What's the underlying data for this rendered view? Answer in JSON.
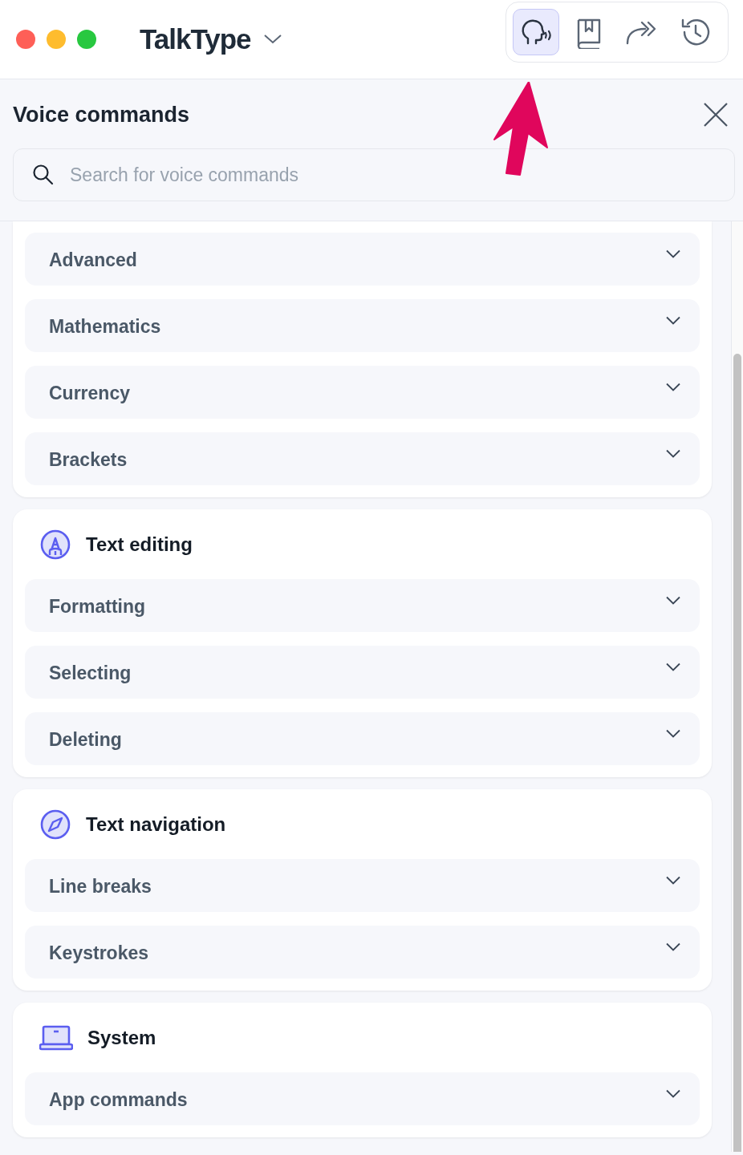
{
  "window": {
    "title": "TalkType",
    "traffic_lights": [
      {
        "color": "#fe5f57"
      },
      {
        "color": "#febc2e"
      },
      {
        "color": "#28c840"
      }
    ]
  },
  "toolbar": [
    {
      "kind": "voice",
      "selected": true
    },
    {
      "kind": "book",
      "selected": false
    },
    {
      "kind": "share",
      "selected": false
    },
    {
      "kind": "history",
      "selected": false
    }
  ],
  "panel": {
    "title": "Voice commands",
    "search": {
      "placeholder": "Search for voice commands"
    },
    "sections": [
      {
        "items": [
          {
            "label": "Advanced",
            "expanded": false
          },
          {
            "label": "Mathematics",
            "expanded": false
          },
          {
            "label": "Currency",
            "expanded": false
          },
          {
            "label": "Brackets",
            "expanded": false
          }
        ]
      },
      {
        "kind": "editing",
        "heading": "Text editing",
        "items": [
          {
            "label": "Formatting",
            "expanded": false
          },
          {
            "label": "Selecting",
            "expanded": false
          },
          {
            "label": "Deleting",
            "expanded": false
          }
        ]
      },
      {
        "kind": "navigation",
        "heading": "Text navigation",
        "items": [
          {
            "label": "Line breaks",
            "expanded": false
          },
          {
            "label": "Keystrokes",
            "expanded": false
          }
        ]
      },
      {
        "kind": "system",
        "heading": "System",
        "items": [
          {
            "label": "App commands",
            "expanded": false
          }
        ]
      }
    ]
  }
}
